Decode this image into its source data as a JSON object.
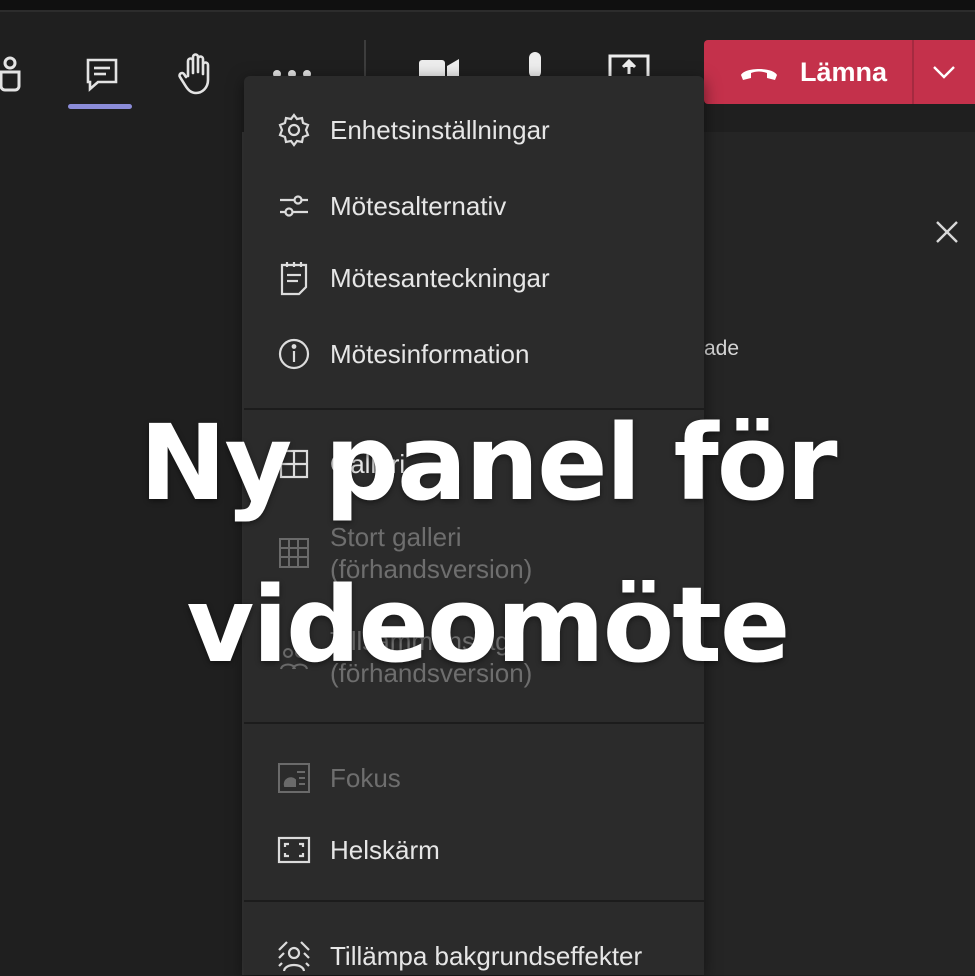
{
  "toolbar": {
    "leave_label": "Lämna"
  },
  "panel": {
    "partial_text": "ade"
  },
  "menu": {
    "items": [
      {
        "label": "Enhetsinställningar",
        "icon": "gear-icon"
      },
      {
        "label": "Mötesalternativ",
        "icon": "sliders-icon"
      },
      {
        "label": "Mötesanteckningar",
        "icon": "notes-icon"
      },
      {
        "label": "Mötesinformation",
        "icon": "info-icon"
      },
      {
        "label": "Galleri",
        "icon": "gallery-icon"
      },
      {
        "label": "Stort galleri\n(förhandsversion)",
        "icon": "large-gallery-icon"
      },
      {
        "label": "Tillsammansläge\n(förhandsversion)",
        "icon": "together-mode-icon"
      },
      {
        "label": "Fokus",
        "icon": "focus-icon"
      },
      {
        "label": "Helskärm",
        "icon": "fullscreen-icon"
      },
      {
        "label": "Tillämpa bakgrundseffekter",
        "icon": "background-effects-icon"
      }
    ]
  },
  "overlay": {
    "line1": "Ny panel för",
    "line2": "videomöte"
  },
  "colors": {
    "leave_red": "#c4314b",
    "accent_purple": "#8b8cd9",
    "menu_bg": "#2b2b2b"
  }
}
